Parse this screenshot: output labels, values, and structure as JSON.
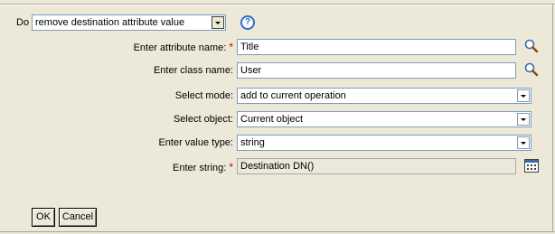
{
  "do_row": {
    "label": "Do",
    "action_value": "remove destination attribute value"
  },
  "fields": {
    "attribute_name": {
      "label": "Enter attribute name:",
      "value": "Title",
      "required_mark": "*"
    },
    "class_name": {
      "label": "Enter class name:",
      "value": "User"
    },
    "mode": {
      "label": "Select mode:",
      "value": "add to current operation"
    },
    "object": {
      "label": "Select object:",
      "value": "Current object"
    },
    "value_type": {
      "label": "Enter value type:",
      "value": "string"
    },
    "string": {
      "label": "Enter string:",
      "value": "Destination DN()",
      "required_mark": "*"
    }
  },
  "icons": {
    "help": "question-mark-help-icon",
    "browse": "magnifier-icon",
    "editor": "argument-builder-icon"
  },
  "help_glyph": "?",
  "buttons": {
    "ok": "OK",
    "cancel": "Cancel"
  },
  "colors": {
    "required": "#cc0000",
    "background": "#ece9d8",
    "help": "#2c6bd1"
  }
}
